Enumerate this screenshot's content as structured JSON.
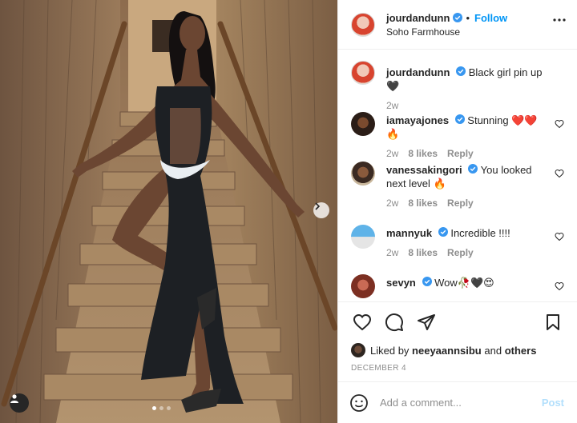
{
  "header": {
    "username": "jourdandunn",
    "follow_label": "Follow",
    "location": "Soho Farmhouse",
    "more_icon": "more-horizontal-icon"
  },
  "caption": {
    "username": "jourdandunn",
    "text": "Black girl pin up 🖤",
    "time": "2w"
  },
  "comments": [
    {
      "username": "iamayajones",
      "text": "Stunning ❤️❤️🔥",
      "time": "2w",
      "likes": "8 likes",
      "reply": "Reply"
    },
    {
      "username": "vanessakingori",
      "text": "You looked next level 🔥",
      "time": "2w",
      "likes": "8 likes",
      "reply": "Reply"
    },
    {
      "username": "mannyuk",
      "text": "Incredible !!!!",
      "time": "2w",
      "likes": "8 likes",
      "reply": "Reply"
    },
    {
      "username": "sevyn",
      "text": "Wow🥀🖤😍",
      "time": "",
      "likes": "",
      "reply": ""
    }
  ],
  "likes": {
    "prefix": "Liked by",
    "user": "neeyaannsibu",
    "conj": "and",
    "others": "others"
  },
  "date": "DECEMBER 4",
  "add_comment": {
    "placeholder": "Add a comment...",
    "post_label": "Post"
  },
  "colors": {
    "accent": "#0095f6",
    "post_disabled": "#b2dffc",
    "muted": "#8e8e8e",
    "verified": "#3897f0"
  },
  "carousel": {
    "slides": 3,
    "active": 1
  }
}
